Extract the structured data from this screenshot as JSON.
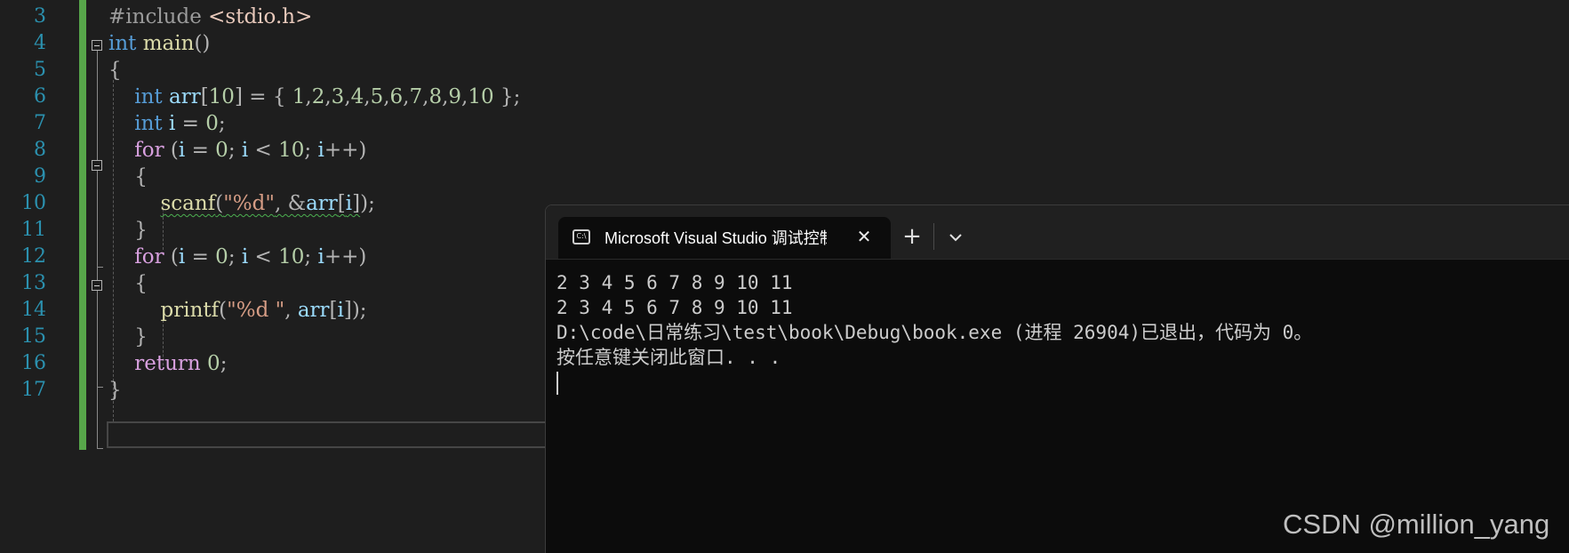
{
  "editor": {
    "lines": [
      {
        "num": "3",
        "tokens": [
          {
            "t": "#include ",
            "c": "pre"
          },
          {
            "t": "<stdio.h>",
            "c": "inc"
          }
        ]
      },
      {
        "num": "4",
        "tokens": [
          {
            "t": "int",
            "c": "kw"
          },
          {
            "t": " ",
            "c": ""
          },
          {
            "t": "main",
            "c": "fn"
          },
          {
            "t": "()",
            "c": "pun"
          }
        ]
      },
      {
        "num": "5",
        "tokens": [
          {
            "t": "{",
            "c": "pun"
          }
        ]
      },
      {
        "num": "6",
        "tokens": [
          {
            "t": "    ",
            "c": ""
          },
          {
            "t": "int",
            "c": "kw"
          },
          {
            "t": " ",
            "c": ""
          },
          {
            "t": "arr",
            "c": "var"
          },
          {
            "t": "[",
            "c": "pun"
          },
          {
            "t": "10",
            "c": "num"
          },
          {
            "t": "] = { ",
            "c": "pun"
          },
          {
            "t": "1",
            "c": "num"
          },
          {
            "t": ",",
            "c": "pun"
          },
          {
            "t": "2",
            "c": "num"
          },
          {
            "t": ",",
            "c": "pun"
          },
          {
            "t": "3",
            "c": "num"
          },
          {
            "t": ",",
            "c": "pun"
          },
          {
            "t": "4",
            "c": "num"
          },
          {
            "t": ",",
            "c": "pun"
          },
          {
            "t": "5",
            "c": "num"
          },
          {
            "t": ",",
            "c": "pun"
          },
          {
            "t": "6",
            "c": "num"
          },
          {
            "t": ",",
            "c": "pun"
          },
          {
            "t": "7",
            "c": "num"
          },
          {
            "t": ",",
            "c": "pun"
          },
          {
            "t": "8",
            "c": "num"
          },
          {
            "t": ",",
            "c": "pun"
          },
          {
            "t": "9",
            "c": "num"
          },
          {
            "t": ",",
            "c": "pun"
          },
          {
            "t": "10",
            "c": "num"
          },
          {
            "t": " };",
            "c": "pun"
          }
        ]
      },
      {
        "num": "7",
        "tokens": [
          {
            "t": "    ",
            "c": ""
          },
          {
            "t": "int",
            "c": "kw"
          },
          {
            "t": " ",
            "c": ""
          },
          {
            "t": "i",
            "c": "var"
          },
          {
            "t": " = ",
            "c": "pun"
          },
          {
            "t": "0",
            "c": "num"
          },
          {
            "t": ";",
            "c": "pun"
          }
        ]
      },
      {
        "num": "8",
        "tokens": [
          {
            "t": "    ",
            "c": ""
          },
          {
            "t": "for",
            "c": "ctl"
          },
          {
            "t": " (",
            "c": "pun"
          },
          {
            "t": "i",
            "c": "var"
          },
          {
            "t": " = ",
            "c": "pun"
          },
          {
            "t": "0",
            "c": "num"
          },
          {
            "t": "; ",
            "c": "pun"
          },
          {
            "t": "i",
            "c": "var"
          },
          {
            "t": " < ",
            "c": "pun"
          },
          {
            "t": "10",
            "c": "num"
          },
          {
            "t": "; ",
            "c": "pun"
          },
          {
            "t": "i",
            "c": "var"
          },
          {
            "t": "++)",
            "c": "pun"
          }
        ]
      },
      {
        "num": "9",
        "tokens": [
          {
            "t": "    ",
            "c": ""
          },
          {
            "t": "{",
            "c": "pun"
          }
        ]
      },
      {
        "num": "10",
        "tokens": [
          {
            "t": "        ",
            "c": ""
          },
          {
            "t": "scanf",
            "c": "fn squiggle"
          },
          {
            "t": "(",
            "c": "pun squiggle"
          },
          {
            "t": "\"%d\"",
            "c": "str squiggle"
          },
          {
            "t": ", &",
            "c": "pun squiggle"
          },
          {
            "t": "arr",
            "c": "var squiggle"
          },
          {
            "t": "[",
            "c": "pun squiggle"
          },
          {
            "t": "i",
            "c": "var squiggle"
          },
          {
            "t": "]",
            "c": "pun squiggle"
          },
          {
            "t": ");",
            "c": "pun"
          }
        ]
      },
      {
        "num": "11",
        "tokens": [
          {
            "t": "    ",
            "c": ""
          },
          {
            "t": "}",
            "c": "pun"
          }
        ]
      },
      {
        "num": "12",
        "tokens": [
          {
            "t": "    ",
            "c": ""
          },
          {
            "t": "for",
            "c": "ctl"
          },
          {
            "t": " (",
            "c": "pun"
          },
          {
            "t": "i",
            "c": "var"
          },
          {
            "t": " = ",
            "c": "pun"
          },
          {
            "t": "0",
            "c": "num"
          },
          {
            "t": "; ",
            "c": "pun"
          },
          {
            "t": "i",
            "c": "var"
          },
          {
            "t": " < ",
            "c": "pun"
          },
          {
            "t": "10",
            "c": "num"
          },
          {
            "t": "; ",
            "c": "pun"
          },
          {
            "t": "i",
            "c": "var"
          },
          {
            "t": "++)",
            "c": "pun"
          }
        ]
      },
      {
        "num": "13",
        "tokens": [
          {
            "t": "    ",
            "c": ""
          },
          {
            "t": "{",
            "c": "pun"
          }
        ]
      },
      {
        "num": "14",
        "tokens": [
          {
            "t": "        ",
            "c": ""
          },
          {
            "t": "printf",
            "c": "fn"
          },
          {
            "t": "(",
            "c": "pun"
          },
          {
            "t": "\"%d \"",
            "c": "str"
          },
          {
            "t": ", ",
            "c": "pun"
          },
          {
            "t": "arr",
            "c": "var"
          },
          {
            "t": "[",
            "c": "pun"
          },
          {
            "t": "i",
            "c": "var"
          },
          {
            "t": "]);",
            "c": "pun"
          }
        ]
      },
      {
        "num": "15",
        "tokens": [
          {
            "t": "    ",
            "c": ""
          },
          {
            "t": "}",
            "c": "pun"
          }
        ]
      },
      {
        "num": "16",
        "tokens": [
          {
            "t": "    ",
            "c": ""
          },
          {
            "t": "return",
            "c": "ctl"
          },
          {
            "t": " ",
            "c": ""
          },
          {
            "t": "0",
            "c": "num"
          },
          {
            "t": ";",
            "c": "pun"
          }
        ]
      },
      {
        "num": "17",
        "tokens": [
          {
            "t": "}",
            "c": "pun"
          }
        ]
      }
    ]
  },
  "terminal": {
    "tab_icon_text": "C:\\",
    "tab_title": "Microsoft Visual Studio 调试控制台",
    "close_glyph": "✕",
    "new_tab_glyph": "+",
    "lines": [
      "2 3 4 5 6 7 8 9 10 11",
      "2 3 4 5 6 7 8 9 10 11",
      "D:\\code\\日常练习\\test\\book\\Debug\\book.exe (进程 26904)已退出，代码为 0。",
      "按任意键关闭此窗口. . ."
    ]
  },
  "watermark": "CSDN @million_yang"
}
